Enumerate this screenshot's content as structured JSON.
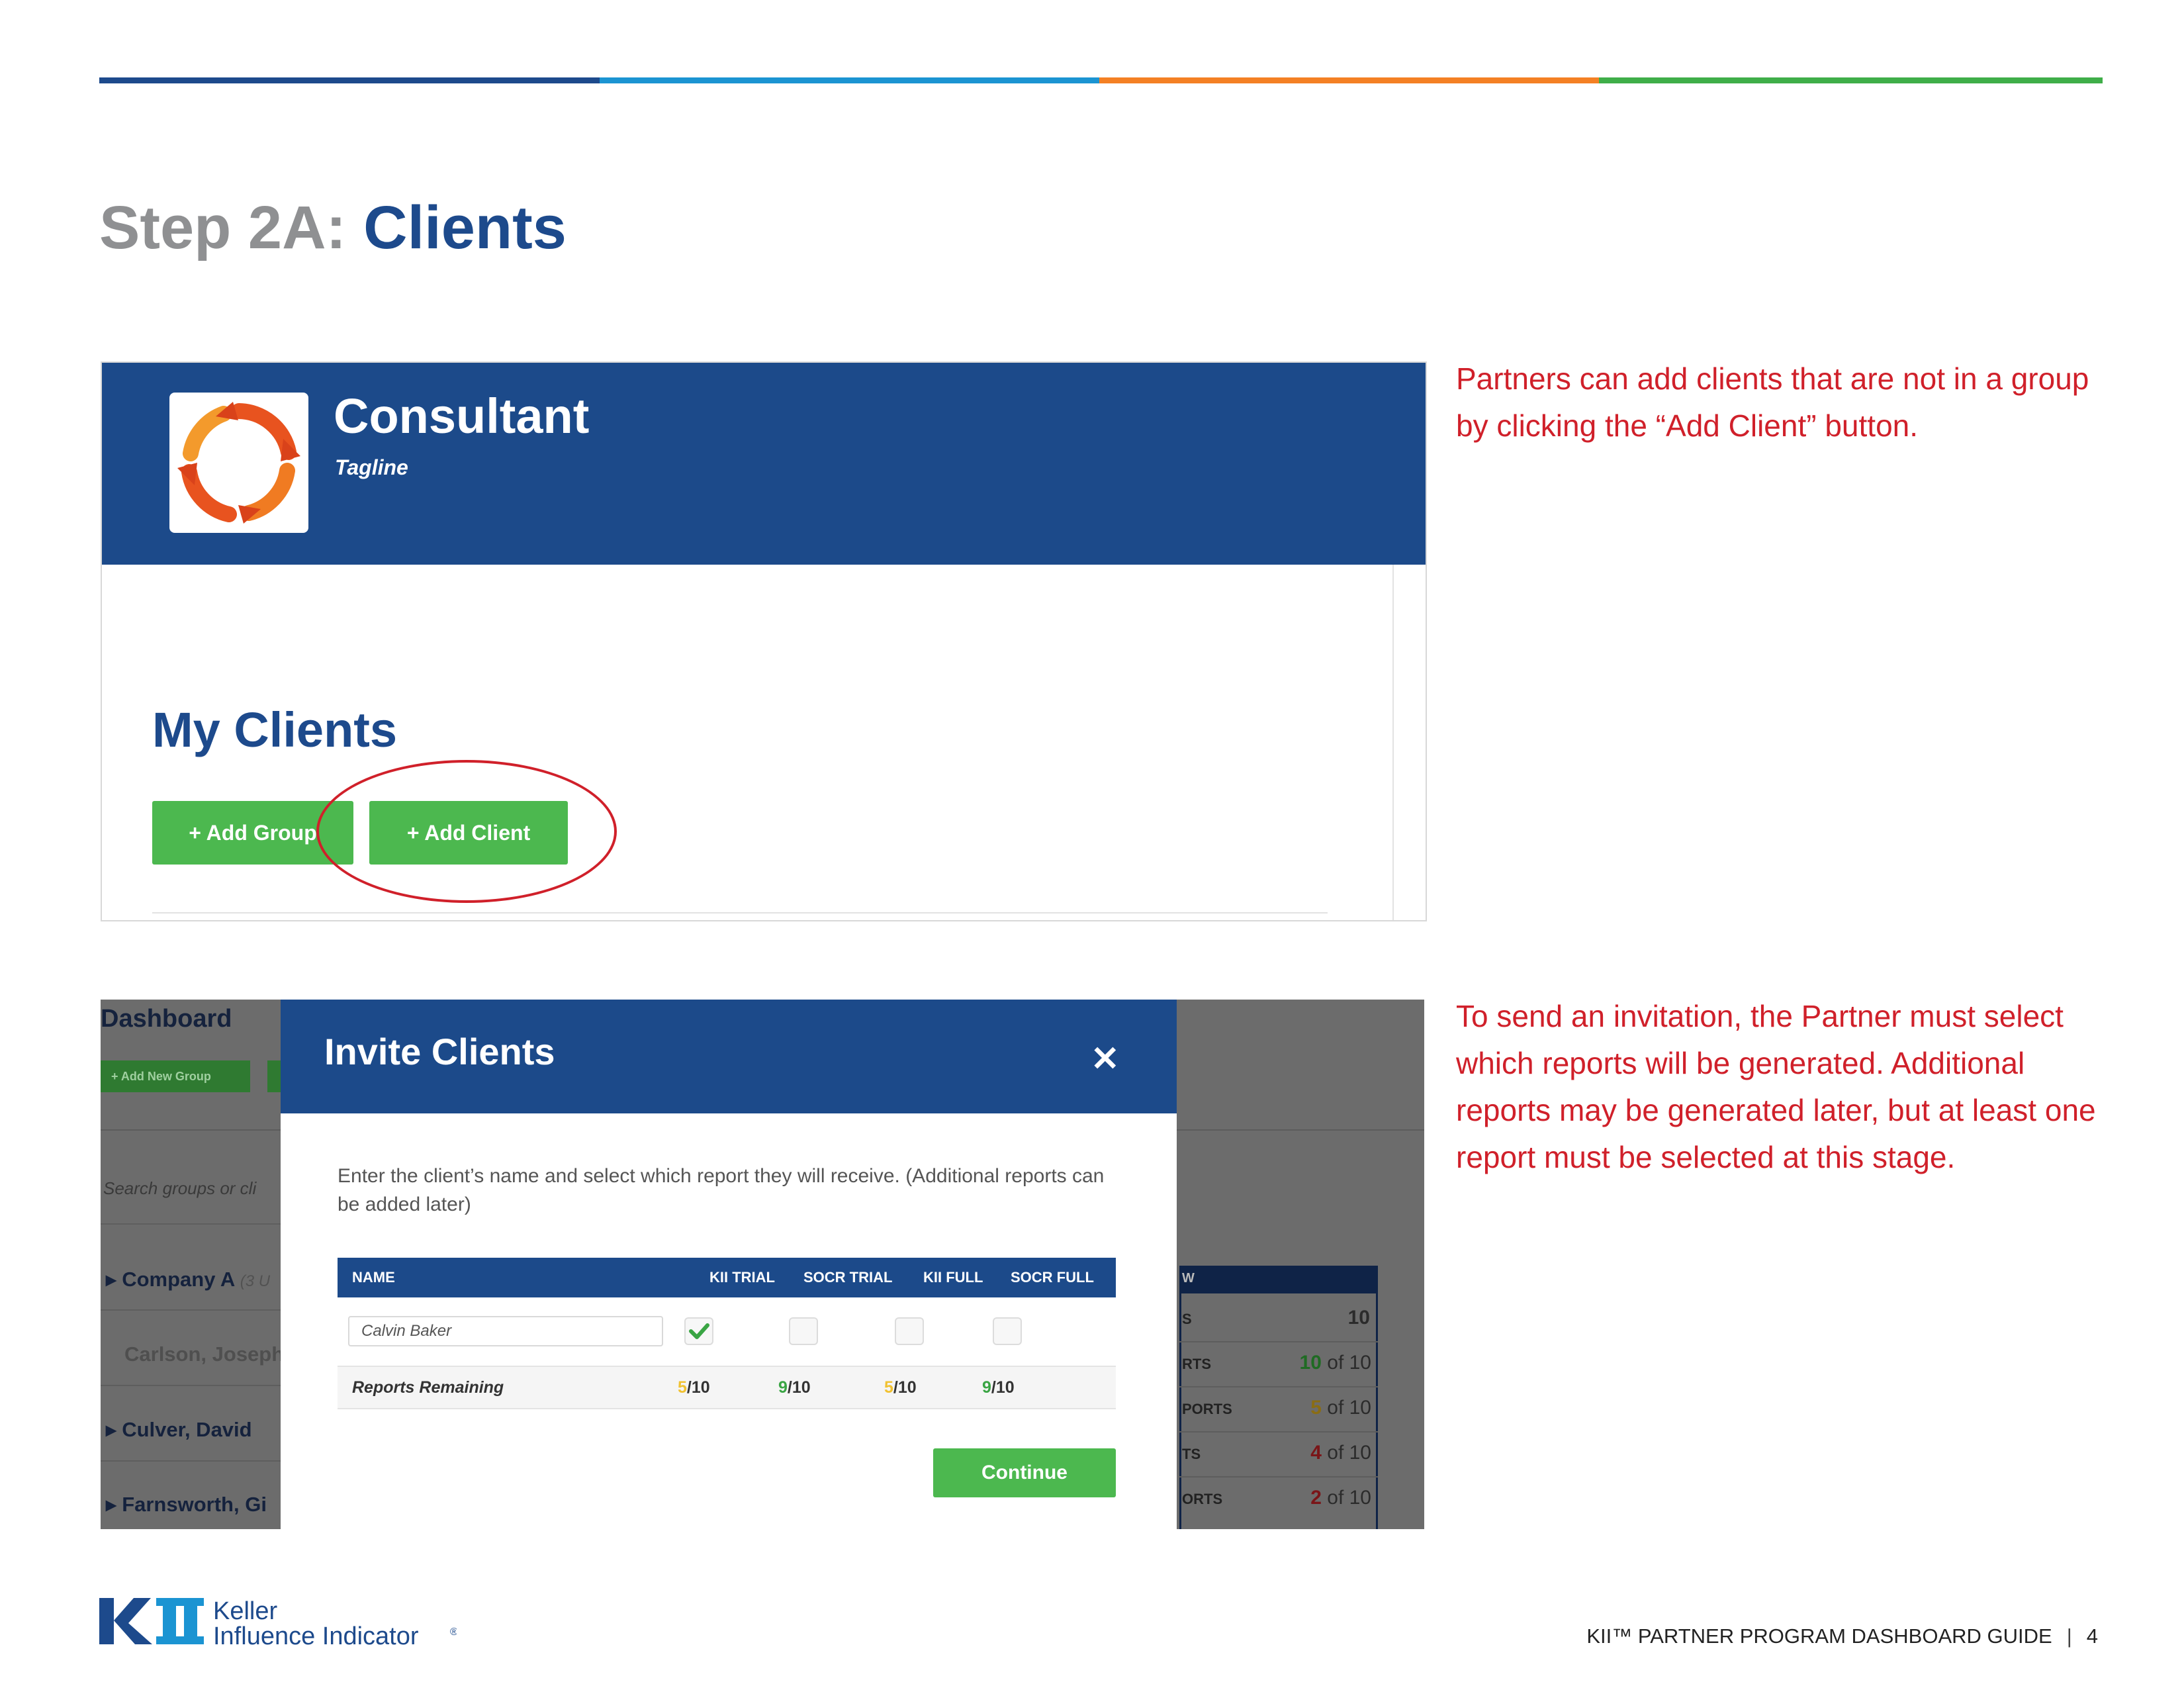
{
  "page": {
    "step_label": "Step 2A:",
    "step_title": "Clients"
  },
  "colors": {
    "brand_blue": "#1d4a8c",
    "accent_light_blue": "#1b94d2",
    "accent_orange": "#f48024",
    "accent_green": "#3fae49",
    "button_green": "#4cb84f",
    "note_red": "#d0202a"
  },
  "screenshot1": {
    "consultant_name": "Consultant",
    "tagline": "Tagline",
    "logo_icon": "circular-arrows-logo-icon",
    "section_title": "My Clients",
    "add_group_label": "+ Add Group",
    "add_client_label": "+ Add Client"
  },
  "note1": "Partners can add clients that are not in a group by clicking the “Add Client” button.",
  "screenshot2": {
    "background": {
      "dashboard_title": "Dashboard",
      "add_new_group_label": "+ Add New Group",
      "search_placeholder": "Search groups or cli",
      "rows": [
        {
          "name": "Company A",
          "sub": "(3 U"
        },
        {
          "name": "Carlson, Joseph"
        },
        {
          "name": "Culver, David"
        },
        {
          "name": "Farnsworth, Gi"
        }
      ],
      "panel_head": "W",
      "panel_rows": [
        {
          "label": "S",
          "value": "10"
        },
        {
          "label": "RTS",
          "used": "10",
          "total": "of 10"
        },
        {
          "label": "PORTS",
          "used": "5",
          "total": "of 10"
        },
        {
          "label": "TS",
          "used": "4",
          "total": "of 10"
        },
        {
          "label": "ORTS",
          "used": "2",
          "total": "of 10"
        }
      ]
    },
    "modal": {
      "title": "Invite Clients",
      "close_icon": "close-icon",
      "description": "Enter the client’s name and select which report they will receive. (Additional reports can be added later)",
      "columns": [
        "NAME",
        "KII TRIAL",
        "SOCR TRIAL",
        "KII FULL",
        "SOCR FULL"
      ],
      "client_name_value": "Calvin Baker",
      "checkboxes": [
        true,
        false,
        false,
        false
      ],
      "remaining_label": "Reports Remaining",
      "remaining": [
        {
          "used": "5",
          "total": "/10"
        },
        {
          "used": "9",
          "total": "/10"
        },
        {
          "used": "5",
          "total": "/10"
        },
        {
          "used": "9",
          "total": "/10"
        }
      ],
      "continue_label": "Continue"
    }
  },
  "note2": "To send an invitation, the Partner must select which reports will be generated. Additional reports may be generated later, but at least one report must be selected at this stage.",
  "footer": {
    "logo_line1": "Keller",
    "logo_line2": "Influence Indicator",
    "logo_reg": "®",
    "guide_title": "KII™ PARTNER PROGRAM DASHBOARD GUIDE",
    "separator": "|",
    "page_number": "4"
  }
}
